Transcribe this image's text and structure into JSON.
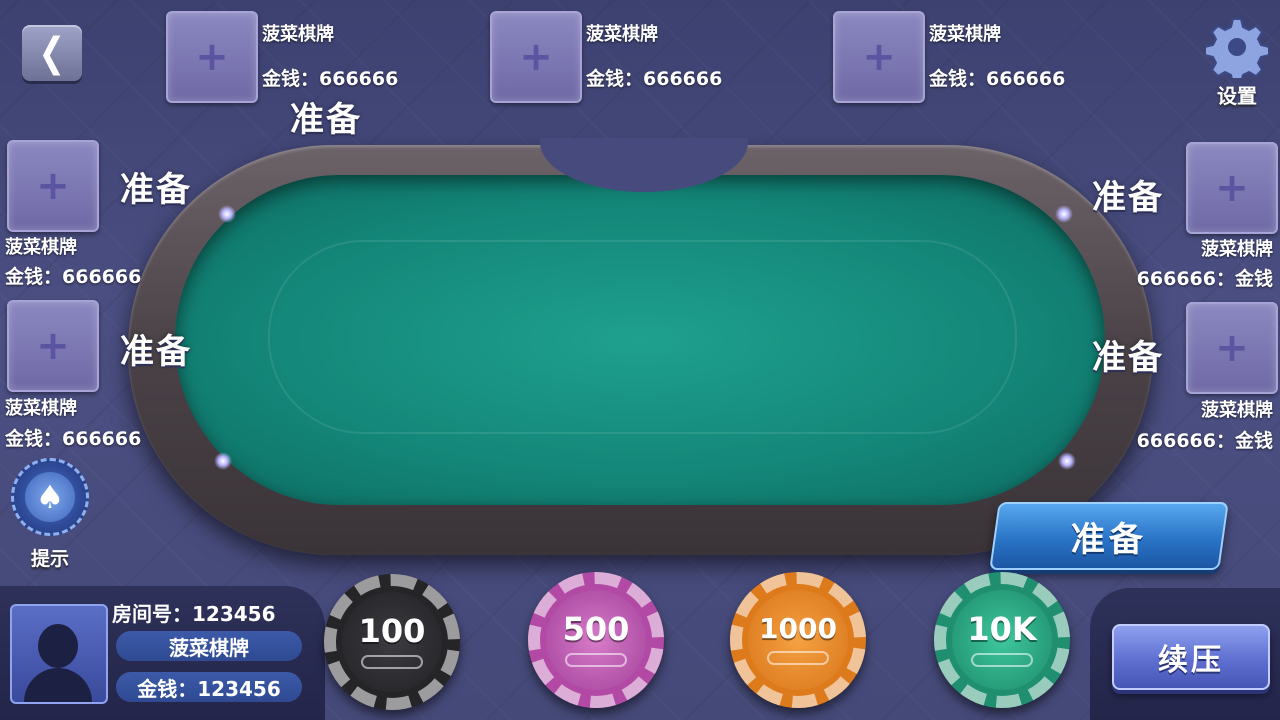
{
  "back_icon": "chevron-left-icon",
  "settings": {
    "label": "设置",
    "icon": "gear-icon"
  },
  "seats": [
    {
      "name": "菠菜棋牌",
      "money": "金钱：666666",
      "status": "准备"
    },
    {
      "name": "菠菜棋牌",
      "money": "金钱：666666"
    },
    {
      "name": "菠菜棋牌",
      "money": "金钱：666666"
    },
    {
      "name": "菠菜棋牌",
      "money": "金钱：666666",
      "status": "准备"
    },
    {
      "name": "菠菜棋牌",
      "money": "金钱：666666",
      "status": "准备"
    },
    {
      "name": "菠菜棋牌",
      "money": "666666：金钱",
      "status": "准备"
    },
    {
      "name": "菠菜棋牌",
      "money": "666666：金钱",
      "status": "准备"
    }
  ],
  "hint": {
    "label": "提示",
    "icon": "spade-icon"
  },
  "ready_button": "准备",
  "player": {
    "room": "房间号：123456",
    "name": "菠菜棋牌",
    "money": "金钱：123456"
  },
  "chips": [
    {
      "value": "100",
      "color": "#252528"
    },
    {
      "value": "500",
      "color": "#b24aa5"
    },
    {
      "value": "1000",
      "color": "#dd7a1c"
    },
    {
      "value": "10K",
      "color": "#1f8f6f"
    }
  ],
  "rebet_button": "续压",
  "colors": {
    "felt": "#14887a",
    "background": "#454978",
    "ready_button": "#2a74c6"
  }
}
